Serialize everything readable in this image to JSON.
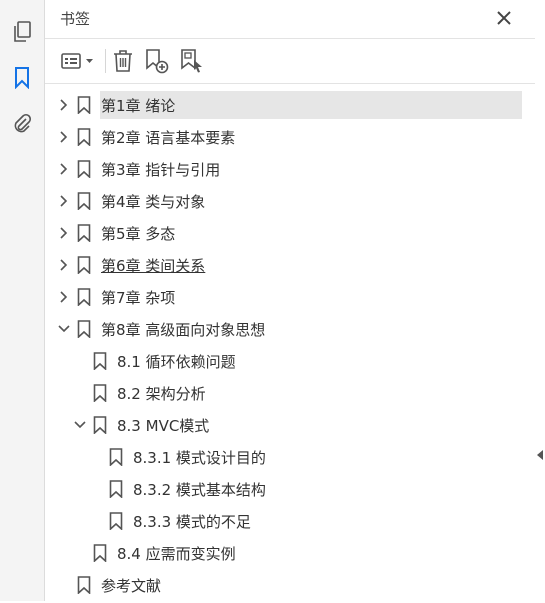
{
  "panel": {
    "title": "书签"
  },
  "rail": {
    "icons": [
      "pages-icon",
      "bookmarks-icon",
      "attachments-icon"
    ]
  },
  "toolbar": {
    "icons": [
      "options-menu-icon",
      "delete-icon",
      "new-bookmark-icon",
      "bookmark-from-selection-icon"
    ]
  },
  "bookmarks": [
    {
      "label": "第1章 绪论",
      "level": 0,
      "state": "collapsed",
      "selected": true
    },
    {
      "label": "第2章 语言基本要素",
      "level": 0,
      "state": "collapsed"
    },
    {
      "label": "第3章 指针与引用",
      "level": 0,
      "state": "collapsed"
    },
    {
      "label": "第4章 类与对象",
      "level": 0,
      "state": "collapsed"
    },
    {
      "label": "第5章 多态",
      "level": 0,
      "state": "collapsed"
    },
    {
      "label": "第6章 类间关系",
      "level": 0,
      "state": "collapsed",
      "underlined": true
    },
    {
      "label": "第7章 杂项",
      "level": 0,
      "state": "collapsed"
    },
    {
      "label": "第8章 高级面向对象思想",
      "level": 0,
      "state": "expanded"
    },
    {
      "label": "8.1 循环依赖问题",
      "level": 1,
      "state": "leaf"
    },
    {
      "label": "8.2 架构分析",
      "level": 1,
      "state": "leaf"
    },
    {
      "label": "8.3 MVC模式",
      "level": 1,
      "state": "expanded"
    },
    {
      "label": "8.3.1 模式设计目的",
      "level": 2,
      "state": "leaf"
    },
    {
      "label": "8.3.2 模式基本结构",
      "level": 2,
      "state": "leaf"
    },
    {
      "label": "8.3.3 模式的不足",
      "level": 2,
      "state": "leaf"
    },
    {
      "label": "8.4 应需而变实例",
      "level": 1,
      "state": "leaf"
    },
    {
      "label": "参考文献",
      "level": 0,
      "state": "leaf"
    }
  ],
  "colors": {
    "accent": "#1473e6",
    "icon": "#555555",
    "selection": "#e6e6e6"
  }
}
